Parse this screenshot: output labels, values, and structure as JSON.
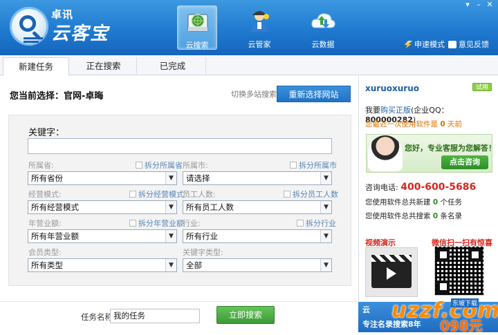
{
  "header": {
    "logo_top": "卓讯",
    "logo_main": "云客宝",
    "nav": [
      {
        "label": "云搜索",
        "icon": "radar-icon",
        "active": true
      },
      {
        "label": "云管家",
        "icon": "user-manager-icon",
        "active": false
      },
      {
        "label": "云数据",
        "icon": "cloud-icon",
        "active": false
      }
    ],
    "mini_mode": "申速模式",
    "feedback": "意见反馈",
    "window_controls": [
      "▾",
      "–",
      "✕"
    ]
  },
  "tabs": [
    {
      "label": "新建任务",
      "active": true
    },
    {
      "label": "正在搜索",
      "active": false
    },
    {
      "label": "已完成",
      "active": false
    }
  ],
  "main": {
    "current_selection": "您当前选择：官网-卓晦",
    "switch_link": "切换多站搜索",
    "reselect_button": "重新选择网站",
    "keyword_label": "关键字：",
    "keyword_value": "",
    "fields": [
      {
        "label": "所属省:",
        "split": "拆分所属省",
        "value": "所有省份"
      },
      {
        "label": "所属市:",
        "split": "拆分所属市",
        "value": "请选择"
      },
      {
        "label": "经营模式:",
        "split": "拆分经营模式",
        "value": "所有经营模式"
      },
      {
        "label": "员工人数:",
        "split": "拆分员工人数",
        "value": "所有员工人数"
      },
      {
        "label": "年营业额:",
        "split": "拆分年营业额",
        "value": "所有年营业额"
      },
      {
        "label": "行业:",
        "split": "拆分行业",
        "value": "所有行业"
      },
      {
        "label": "会员类型:",
        "split": "",
        "value": "所有类型"
      },
      {
        "label": "关键字类型:",
        "split": "",
        "value": "全部"
      }
    ],
    "task_name_label": "任务名称",
    "task_name_value": "我的任务",
    "search_button": "立即搜索"
  },
  "side": {
    "username": "xuruoxuruo",
    "badge": "试用",
    "buy_prefix": "我要",
    "buy_link": "购买正版",
    "qq_prefix": "(企业QQ：",
    "qq": "800000282",
    "qq_suffix": ")",
    "last_used_prefix": "您最近一次使用软件是",
    "last_used_days": "0",
    "last_used_suffix": "天前",
    "cs_text": "您好，专业客服为您解答！",
    "consult_button": "点击咨询",
    "phone_label": "咨询电话:",
    "phone": "400-600-5686",
    "task_prefix": "您使用软件总共新建",
    "task_count": "0",
    "task_suffix": "个任务",
    "search_prefix": "您使用软件总共搜索",
    "search_count": "0",
    "search_suffix": "条名录",
    "video_title": "视频演示",
    "qr_title": "微信扫一扫有惊喜",
    "promo_a": "云",
    "promo_b": "专注名录搜索8年",
    "watermark": "uzzf.com",
    "watermark_sub": "东坡下载",
    "price": "098元"
  }
}
